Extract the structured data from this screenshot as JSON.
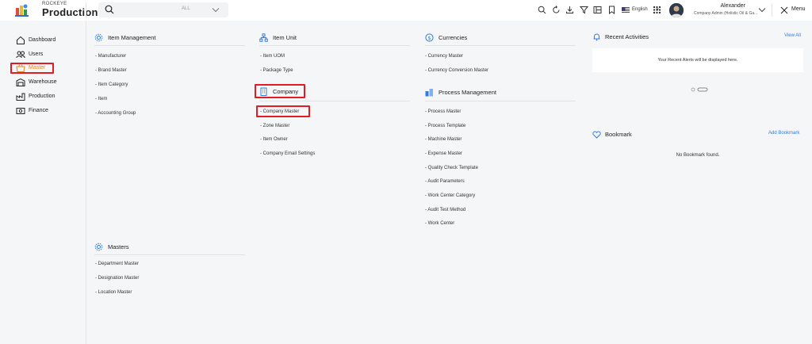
{
  "header": {
    "brand_small": "ROCKEYE",
    "brand_big": "Production",
    "search_placeholder": "",
    "search_scope": "ALL",
    "language": "English",
    "user_name": "Alexander",
    "user_role": "Company Admin (Holistic Oil & Ga...",
    "menu_label": "Menu"
  },
  "sidebar": {
    "items": [
      {
        "label": "Dashboard",
        "icon": "home-icon"
      },
      {
        "label": "Users",
        "icon": "users-icon"
      },
      {
        "label": "Master",
        "icon": "master-basket-icon",
        "active": true
      },
      {
        "label": "Warehouse",
        "icon": "warehouse-icon"
      },
      {
        "label": "Production",
        "icon": "production-icon"
      },
      {
        "label": "Finance",
        "icon": "finance-icon"
      }
    ]
  },
  "sections": {
    "item_management": {
      "title": "Item Management",
      "links": [
        "- Manufacturer",
        "- Brand Master",
        "- Item Category",
        "- Item",
        "- Accounting Group"
      ]
    },
    "masters": {
      "title": "Masters",
      "links": [
        "- Department Master",
        "- Designation Master",
        "- Location Master"
      ]
    },
    "item_unit": {
      "title": "Item Unit",
      "links": [
        "- Item UOM",
        "- Package Type"
      ]
    },
    "company": {
      "title": "Company",
      "links": [
        "- Company Master",
        "- Zone Master",
        "- Item Owner",
        "- Company Email Settings"
      ]
    },
    "currencies": {
      "title": "Currencies",
      "links": [
        "- Currency Master",
        "- Currency Conversion Master"
      ]
    },
    "process_management": {
      "title": "Process Management",
      "links": [
        "- Process Master",
        "- Process Template",
        "- Machine Master",
        "- Expense Master",
        "- Quality Check Template",
        "- Audit Parameters",
        "- Work Center Category",
        "- Audit Test Method",
        "- Work Center"
      ]
    }
  },
  "recent": {
    "title": "Recent Activities",
    "action": "View All",
    "empty_text": "Your Recent Alerts will be displayed here."
  },
  "bookmark": {
    "title": "Bookmark",
    "action": "Add Bookmark",
    "empty_text": "No Bookmark found."
  },
  "colors": {
    "accent": "#e08a26",
    "highlight_box": "#e31b23",
    "link_blue": "#2b7de9"
  }
}
